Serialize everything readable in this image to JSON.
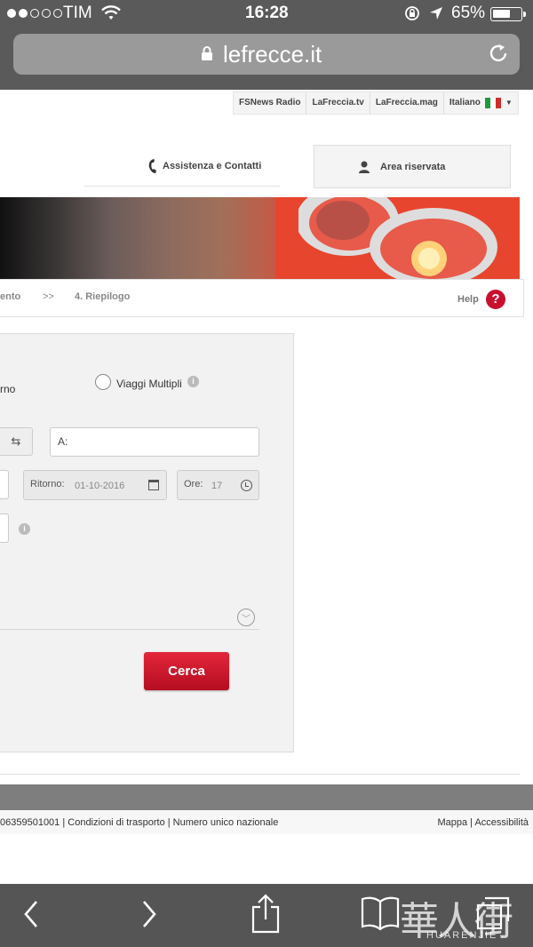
{
  "status_bar": {
    "carrier": "TIM",
    "time": "16:28",
    "battery": "65%",
    "battery_level": 0.65
  },
  "browser": {
    "url": "lefrecce.it"
  },
  "utility_bar": {
    "links": [
      "FSNews Radio",
      "LaFreccia.tv",
      "LaFreccia.mag"
    ],
    "language": "Italiano"
  },
  "header": {
    "assistenza": "Assistenza e Contatti",
    "area_riservata": "Area riservata"
  },
  "breadcrumb": {
    "previous": "ento",
    "separator": ">>",
    "current": "4. Riepilogo",
    "help": "Help",
    "help_symbol": "?"
  },
  "search": {
    "ritorno_radio_partial": "rno",
    "multiple_trips": "Viaggi Multipli",
    "to_label": "A:",
    "return_label": "Ritorno:",
    "return_date": "01-10-2016",
    "time_label": "Ore:",
    "time_value": "17",
    "submit": "Cerca"
  },
  "footer": {
    "left": "06359501001  |  Condizioni di trasporto |  Numero unico nazionale",
    "right": "Mappa   |   Accessibilità"
  },
  "watermark": {
    "main": "華人街",
    "sub": "HUARENJIE"
  },
  "colors": {
    "brand_red": "#c8102e",
    "browser_chrome": "#5a5a5a"
  }
}
